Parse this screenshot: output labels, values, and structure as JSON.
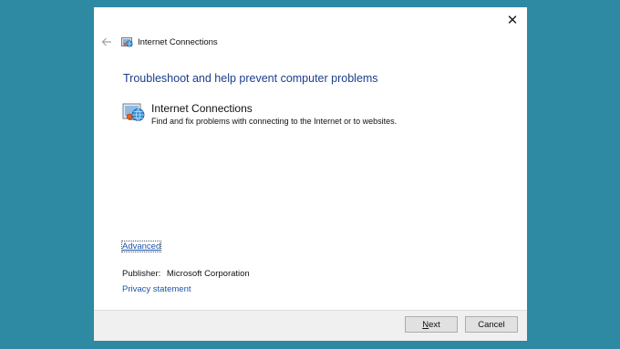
{
  "window": {
    "close_glyph": "✕",
    "title": "Internet Connections",
    "title_icon": "internet-connections-icon",
    "back_icon": "back-arrow-icon"
  },
  "main": {
    "heading": "Troubleshoot and help prevent computer problems",
    "item": {
      "title": "Internet Connections",
      "description": "Find and fix problems with connecting to the Internet or to websites.",
      "icon": "internet-connections-icon"
    },
    "advanced_label": "Advanced",
    "publisher_label": "Publisher:",
    "publisher_value": "Microsoft Corporation",
    "privacy_label": "Privacy statement"
  },
  "footer": {
    "next_accel": "N",
    "next_rest": "ext",
    "cancel_label": "Cancel"
  },
  "colors": {
    "background": "#2e8aa3",
    "heading": "#1a3e8c",
    "link": "#1a55a8",
    "footer": "#f0f0f0"
  }
}
